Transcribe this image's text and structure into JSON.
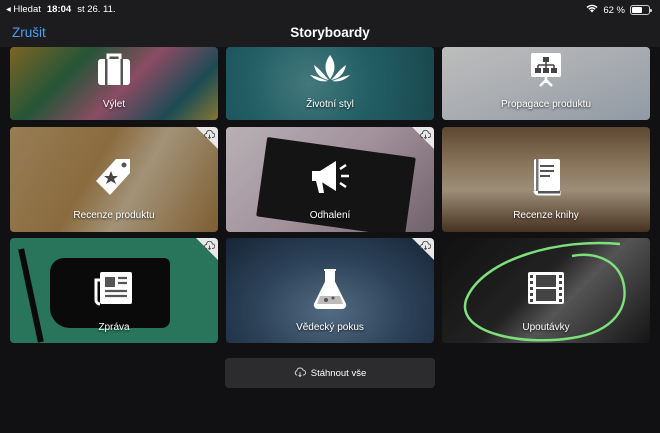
{
  "status": {
    "back_app": "◂ Hledat",
    "time": "18:04",
    "date": "st 26. 11.",
    "battery_text": "62 %",
    "battery_level": 0.62
  },
  "nav": {
    "cancel_label": "Zrušit",
    "title": "Storyboardy"
  },
  "tiles": [
    {
      "label": "Výlet",
      "icon": "suitcase-icon",
      "downloadable": false
    },
    {
      "label": "Životní styl",
      "icon": "lotus-icon",
      "downloadable": false
    },
    {
      "label": "Propagace produktu",
      "icon": "presentation-icon",
      "downloadable": false
    },
    {
      "label": "Recenze produktu",
      "icon": "star-tag-icon",
      "downloadable": true
    },
    {
      "label": "Odhalení",
      "icon": "megaphone-icon",
      "downloadable": true
    },
    {
      "label": "Recenze knihy",
      "icon": "book-icon",
      "downloadable": false
    },
    {
      "label": "Zpráva",
      "icon": "newspaper-icon",
      "downloadable": true
    },
    {
      "label": "Vědecký pokus",
      "icon": "flask-icon",
      "downloadable": true
    },
    {
      "label": "Upoutávky",
      "icon": "film-icon",
      "downloadable": false
    }
  ],
  "download_all_label": "Stáhnout vše",
  "colors": {
    "accent": "#4aa0f5",
    "highlight_circle": "#7ee07a"
  }
}
